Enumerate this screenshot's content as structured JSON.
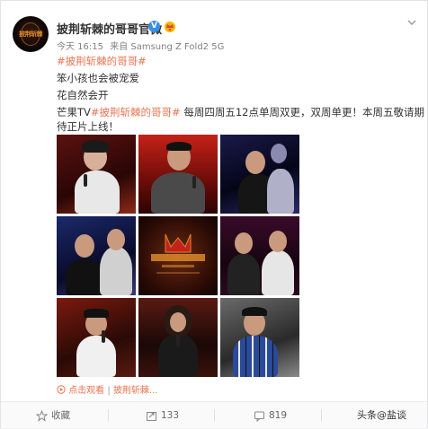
{
  "post": {
    "username": "披荆斩棘的哥哥官微",
    "verified_badge": "V",
    "time": "今天 16:15",
    "source_prefix": "来自",
    "source": "Samsung Z Fold2 5G",
    "avatar_logo_text": "披荆斩棘",
    "lines": {
      "line1": "#披荆斩棘的哥哥#",
      "line2": "笨小孩也会被宠爱",
      "line3": "花自然会开",
      "line4_prefix": "芒果TV",
      "line4_topic": "#披荆斩棘的哥哥#",
      "line4_rest": " 每周四周五12点单周双更，双周单更！本周五敬请期",
      "line5": "待正片上线！"
    },
    "action_line": {
      "watch": "点击观看",
      "sep": "|",
      "link": "披荆斩棘..."
    }
  },
  "footer": {
    "favorite_label": "收藏",
    "repost_count": "133",
    "comment_count": "819"
  },
  "watermark": "头条@盐谈",
  "colors": {
    "topic": "#eb7350",
    "meta": "#808080",
    "verified": "#3a8ee6"
  }
}
